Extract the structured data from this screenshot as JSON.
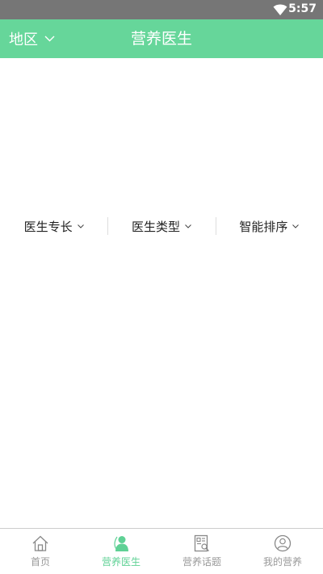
{
  "colors": {
    "primary": "#66d69a",
    "active_tab": "#5fd195",
    "status_bar": "#767676"
  },
  "status_bar": {
    "time": "5:57",
    "icon": "wifi-icon"
  },
  "header": {
    "region_label": "地区",
    "region_icon": "chevron-down-icon",
    "title": "营养医生"
  },
  "filters": [
    {
      "label": "医生专长",
      "icon": "chevron-down-icon"
    },
    {
      "label": "医生类型",
      "icon": "chevron-down-icon"
    },
    {
      "label": "智能排序",
      "icon": "chevron-down-icon"
    }
  ],
  "tabs": [
    {
      "label": "首页",
      "icon": "home-icon",
      "active": false
    },
    {
      "label": "营养医生",
      "icon": "doctor-icon",
      "active": true
    },
    {
      "label": "营养话题",
      "icon": "topic-icon",
      "active": false
    },
    {
      "label": "我的营养",
      "icon": "profile-icon",
      "active": false
    }
  ]
}
